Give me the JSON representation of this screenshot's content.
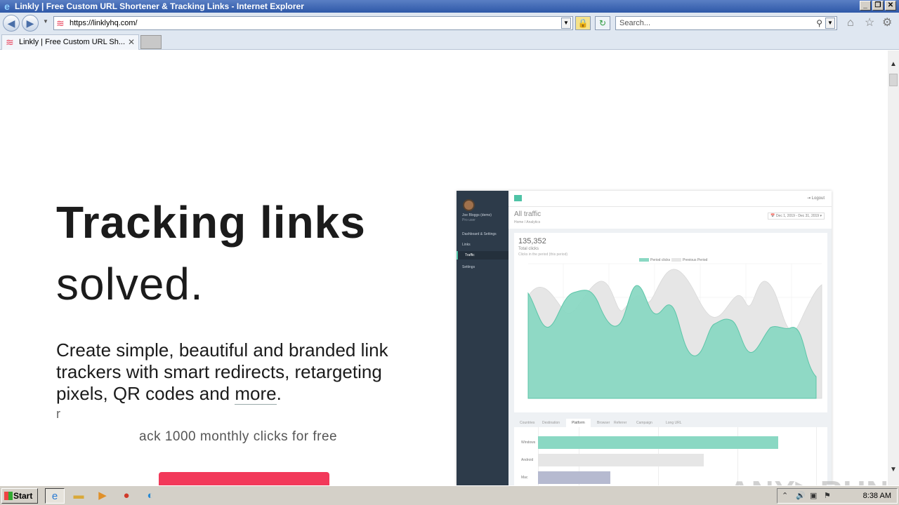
{
  "window": {
    "title": "Linkly | Free Custom URL Shortener & Tracking Links - Internet Explorer",
    "controls": {
      "minimize": "_",
      "maximize": "❐",
      "close": "✕"
    }
  },
  "toolbar": {
    "address": "https://linklyhq.com/",
    "search_placeholder": "Search...",
    "back_glyph": "◀",
    "forward_glyph": "▶",
    "lock_glyph": "🔒",
    "refresh_glyph": "↻"
  },
  "tabs": [
    {
      "label": "Linkly | Free Custom URL Sh..."
    }
  ],
  "hero": {
    "headline": "Tracking links",
    "subheadline": "solved.",
    "description_prefix": "Create simple, beautiful and branded link trackers with smart redirects, retargeting pixels, QR codes and ",
    "description_link": "more",
    "description_suffix": ".",
    "stray_char": "r",
    "free_text": "ack 1000 monthly clicks for free"
  },
  "dashboard": {
    "title": "All traffic",
    "subtitle": "Home / Analytics",
    "total_clicks": "135,352",
    "total_label": "Total clicks",
    "total_sub": "Clicks in the period (this period)",
    "legend": [
      "Period clicks",
      "Previous Period"
    ],
    "logout": "⇥ Logout",
    "date_range": "📅 Dec 1, 2019 - Dec 31, 2019 ▾",
    "sidebar_user": "Joe Bloggs (demo)",
    "sidebar_role": "Pro user",
    "sidebar_items": [
      "Dashboard & Settings",
      "Links",
      "Traffic",
      "Settings"
    ],
    "breakdown_tabs": [
      "Countries",
      "Destination",
      "Platform",
      "Browser",
      "Referrer",
      "Campaign",
      "Long URL"
    ],
    "platform_bars": [
      {
        "label": "Windows",
        "value": 0.9,
        "color": "#8ad8c3"
      },
      {
        "label": "Android",
        "value": 0.62,
        "color": "#e6e6e6"
      },
      {
        "label": "Mac",
        "value": 0.27,
        "color": "#b6bad0"
      }
    ],
    "accent_color": "#4fc3a6"
  },
  "watermark": "ANY▷RUN",
  "taskbar": {
    "start_label": "Start",
    "clock": "8:38 AM",
    "items": [
      "ie-icon",
      "folder-icon",
      "media-icon",
      "chrome-icon",
      "edge-icon"
    ]
  }
}
